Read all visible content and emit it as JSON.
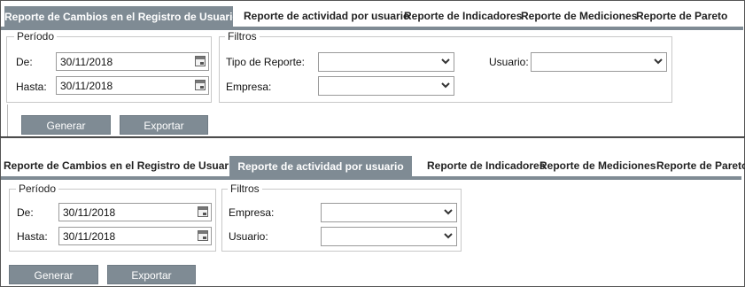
{
  "panels": [
    {
      "tabs": [
        {
          "label": "Reporte de Cambios en el Registro de Usuario"
        },
        {
          "label": "Reporte de actividad por usuario"
        },
        {
          "label": "Reporte de Indicadores"
        },
        {
          "label": "Reporte de Mediciones"
        },
        {
          "label": "Reporte de Pareto"
        }
      ],
      "active_tab": "Reporte de Cambios en el Registro de Usuario",
      "periodo": {
        "legend": "Período",
        "de_label": "De:",
        "de_value": "30/11/2018",
        "hasta_label": "Hasta:",
        "hasta_value": "30/11/2018"
      },
      "filtros": {
        "legend": "Filtros",
        "tipo_label": "Tipo de Reporte:",
        "tipo_value": "",
        "empresa_label": "Empresa:",
        "empresa_value": "",
        "usuario_label": "Usuario:",
        "usuario_value": ""
      },
      "buttons": {
        "generar": "Generar",
        "exportar": "Exportar"
      }
    },
    {
      "tabs": [
        {
          "label": "Reporte de Cambios en el Registro de Usuario"
        },
        {
          "label": "Reporte de actividad por usuario"
        },
        {
          "label": "Reporte de Indicadores"
        },
        {
          "label": "Reporte de Mediciones"
        },
        {
          "label": "Reporte de Pareto"
        }
      ],
      "active_tab": "Reporte de actividad por usuario",
      "periodo": {
        "legend": "Período",
        "de_label": "De:",
        "de_value": "30/11/2018",
        "hasta_label": "Hasta:",
        "hasta_value": "30/11/2018"
      },
      "filtros": {
        "legend": "Filtros",
        "empresa_label": "Empresa:",
        "empresa_value": "",
        "usuario_label": "Usuario:",
        "usuario_value": ""
      },
      "buttons": {
        "generar": "Generar",
        "exportar": "Exportar"
      }
    }
  ],
  "colors": {
    "accent": "#7f8b94",
    "border": "#9a9a9a"
  },
  "icons": {
    "date": "calendar-icon",
    "dropdown": "chevron-down-icon"
  }
}
